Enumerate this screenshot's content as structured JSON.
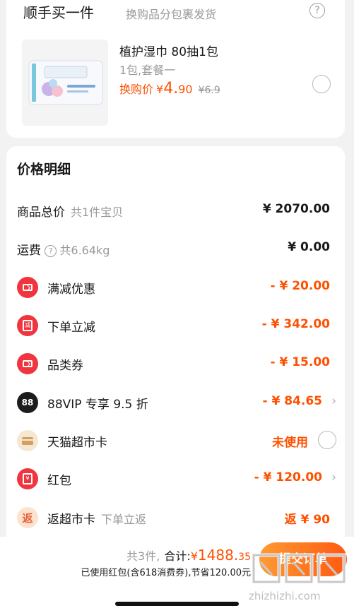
{
  "addon": {
    "title": "顺手买一件",
    "subtitle": "换购品分包裹发货",
    "help_icon": "question-icon",
    "product": {
      "name": "植护湿巾 80抽1包",
      "spec": "1包,套餐一",
      "swap_label": "换购价",
      "currency": "¥",
      "price_int": "4.",
      "price_dec": "90",
      "old_price": "¥6.9",
      "selected": false
    }
  },
  "price_detail": {
    "title": "价格明细",
    "rows": [
      {
        "label": "商品总价",
        "hint": "共1件宝贝",
        "value": "¥ 2070.00"
      },
      {
        "label": "运费",
        "hint": "共6.64kg",
        "value": "¥ 0.00"
      },
      {
        "label": "满减优惠",
        "value": "- ¥ 20.00",
        "icon": "coupon-icon"
      },
      {
        "label": "下单立减",
        "value": "- ¥ 342.00",
        "icon": "discount-bag-icon"
      },
      {
        "label": "品类券",
        "value": "- ¥ 15.00",
        "icon": "coupon-icon"
      },
      {
        "label": "88VIP 专享 9.5 折",
        "value": "- ¥ 84.65",
        "icon": "88vip-icon",
        "icon_text": "88"
      },
      {
        "label": "天猫超市卡",
        "value": "未使用",
        "icon": "card-icon"
      },
      {
        "label": "红包",
        "value": "- ¥ 120.00",
        "icon": "red-packet-icon"
      },
      {
        "label": "返超市卡",
        "hint": "下单立返",
        "value": "返 ¥ 90",
        "icon": "rebate-icon",
        "icon_text": "返"
      }
    ]
  },
  "footer": {
    "count": "共3件,",
    "total_label": "合计:",
    "currency": "¥",
    "total_int": "1488.",
    "total_dec": "35",
    "saving": "已使用红包(含618消费券),节省120.00元",
    "submit": "提交订单",
    "watermark": "zhizhizhi.com"
  },
  "colors": {
    "accent": "#ff5000",
    "red_icon": "#f0353f",
    "background": "#f2f2f2"
  }
}
